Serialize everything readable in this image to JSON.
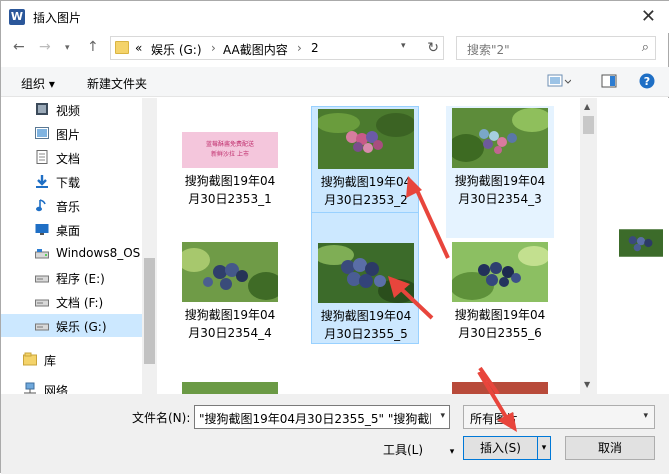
{
  "window": {
    "title": "插入图片",
    "app_icon": "W"
  },
  "address": {
    "prefix": "«",
    "crumbs": [
      "娱乐 (G:)",
      "AA截图内容",
      "2"
    ],
    "separator": "›"
  },
  "search": {
    "placeholder": "搜索\"2\""
  },
  "toolbar": {
    "organize": "组织 ▾",
    "new_folder": "新建文件夹"
  },
  "nav": [
    {
      "label": "视频",
      "icon": "video-icon"
    },
    {
      "label": "图片",
      "icon": "pictures-icon"
    },
    {
      "label": "文档",
      "icon": "documents-icon"
    },
    {
      "label": "下载",
      "icon": "download-icon"
    },
    {
      "label": "音乐",
      "icon": "music-icon"
    },
    {
      "label": "桌面",
      "icon": "desktop-icon"
    },
    {
      "label": "Windows8_OS",
      "icon": "drive-icon"
    },
    {
      "label": "程序 (E:)",
      "icon": "drive-icon"
    },
    {
      "label": "文档 (F:)",
      "icon": "drive-icon"
    },
    {
      "label": "娱乐 (G:)",
      "icon": "drive-icon",
      "selected": true
    },
    {
      "label": "库",
      "icon": "library-icon"
    },
    {
      "label": "网络",
      "icon": "network-icon"
    }
  ],
  "files": [
    {
      "line1": "搜狗截图19年04",
      "line2": "月30日2353_1",
      "state": "normal"
    },
    {
      "line1": "搜狗截图19年04",
      "line2": "月30日2353_2",
      "state": "selected"
    },
    {
      "line1": "搜狗截图19年04",
      "line2": "月30日2354_3",
      "state": "hover"
    },
    {
      "line1": "搜狗截图19年04",
      "line2": "月30日2354_4",
      "state": "normal"
    },
    {
      "line1": "搜狗截图19年04",
      "line2": "月30日2355_5",
      "state": "selected"
    },
    {
      "line1": "搜狗截图19年04",
      "line2": "月30日2355_6",
      "state": "normal"
    }
  ],
  "thumb1_text": [
    "蓝莓酥酱免费配送",
    "新鲜沙拉 上市"
  ],
  "bottom": {
    "filename_label": "文件名(N):",
    "filename_value": "\"搜狗截图19年04月30日2355_5\" \"搜狗截图",
    "filetype_value": "所有图片",
    "tools_label": "工具(L)",
    "insert_label": "插入(S)",
    "cancel_label": "取消"
  },
  "colors": {
    "selected": "#cce8ff",
    "accent_arrow": "#e8453c",
    "word_blue": "#2b579a"
  }
}
